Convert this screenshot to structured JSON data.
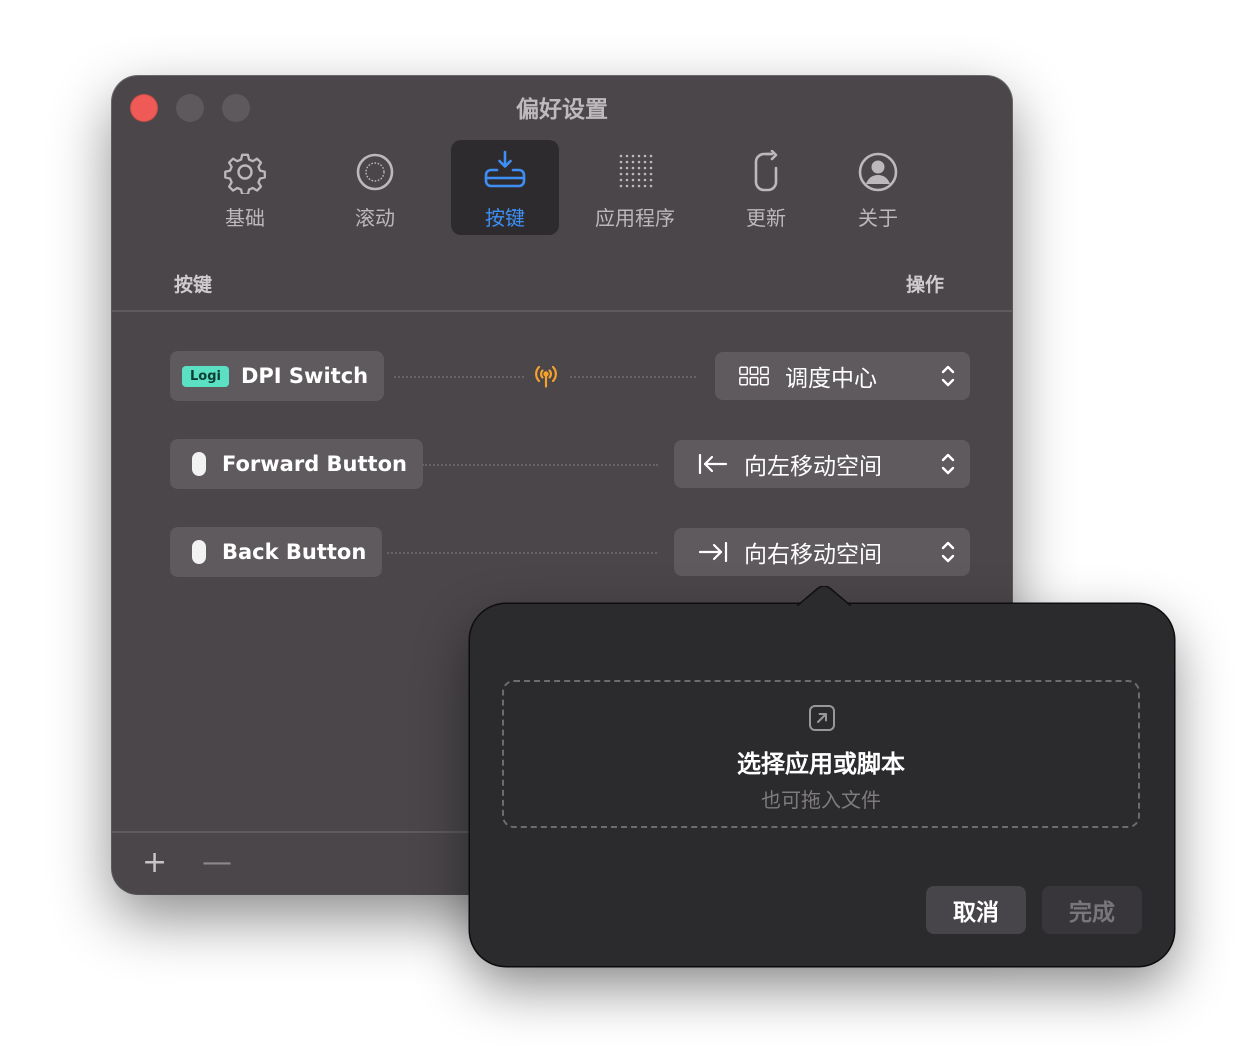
{
  "window": {
    "title": "偏好设置"
  },
  "toolbar": {
    "items": [
      {
        "label": "基础",
        "icon": "gear-icon"
      },
      {
        "label": "滚动",
        "icon": "scroll-wheel-icon"
      },
      {
        "label": "按键",
        "icon": "button-tray-icon",
        "selected": true
      },
      {
        "label": "应用程序",
        "icon": "app-grid-icon"
      },
      {
        "label": "更新",
        "icon": "update-icon"
      },
      {
        "label": "关于",
        "icon": "person-circle-icon"
      }
    ]
  },
  "table": {
    "header_left": "按键",
    "header_right": "操作",
    "rows": [
      {
        "badge": "Logi",
        "button": "DPI Switch",
        "connection_icon": "wireless-icon",
        "action": "调度中心",
        "action_icon": "mission-control-icon"
      },
      {
        "button": "Forward Button",
        "button_icon": "mouse-icon",
        "action": "向左移动空间",
        "action_icon": "arrow-left-bar-icon"
      },
      {
        "button": "Back Button",
        "button_icon": "mouse-icon",
        "action": "向右移动空间",
        "action_icon": "arrow-right-bar-icon"
      }
    ]
  },
  "footer": {
    "add_label": "+",
    "remove_label": "—"
  },
  "popover": {
    "drop_title": "选择应用或脚本",
    "drop_subtitle": "也可拖入文件",
    "cancel_label": "取消",
    "done_label": "完成"
  },
  "colors": {
    "window_bg": "#4a4649",
    "accent": "#3d8ff4",
    "logi_badge": "#5be0c4",
    "wireless_orange": "#f5a12b",
    "close_red": "#ef5a56",
    "popover_bg": "#2b2a2d"
  }
}
